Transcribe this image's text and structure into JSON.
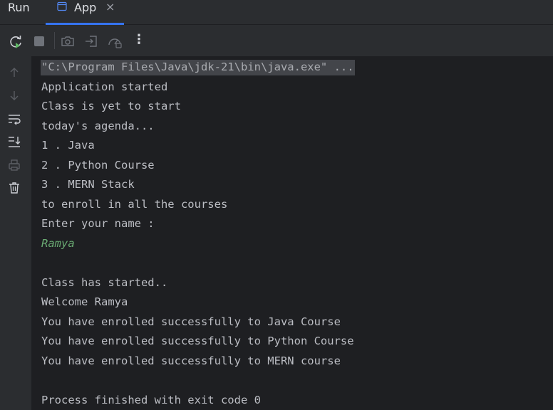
{
  "panel": {
    "title": "Run",
    "tab_label": "App",
    "tab_close": "×",
    "tab_icon": "app-window-icon"
  },
  "toolbar": {
    "buttons": [
      {
        "name": "rerun-icon"
      },
      {
        "name": "stop-icon"
      },
      {
        "name": "camera-icon"
      },
      {
        "name": "exit-icon"
      },
      {
        "name": "speedometer-icon"
      },
      {
        "name": "more-options-icon"
      }
    ],
    "more_label": "⋮"
  },
  "sidebar": {
    "buttons": [
      {
        "name": "up-arrow-icon"
      },
      {
        "name": "down-arrow-icon"
      },
      {
        "name": "soft-wrap-icon"
      },
      {
        "name": "scroll-to-end-icon"
      },
      {
        "name": "print-icon"
      },
      {
        "name": "trash-icon"
      }
    ]
  },
  "console": {
    "command": "\"C:\\Program Files\\Java\\jdk-21\\bin\\java.exe\" ...",
    "lines": [
      "Application started",
      "Class is yet to start",
      "today's agenda...",
      "1 . Java",
      "2 . Python Course",
      "3 . MERN Stack",
      "to enroll in all the courses",
      "Enter your name :"
    ],
    "user_input": "Ramya",
    "lines_after": [
      "Class has started..",
      "Welcome Ramya",
      "You have enrolled successfully to Java Course",
      "You have enrolled successfully to Python Course",
      "You have enrolled successfully to MERN course"
    ],
    "exit_line": "Process finished with exit code 0"
  },
  "colors": {
    "background": "#1e1f22",
    "panel": "#2b2d30",
    "accent": "#3574f0",
    "text": "#bcbec4",
    "input_text": "#6aab73"
  }
}
